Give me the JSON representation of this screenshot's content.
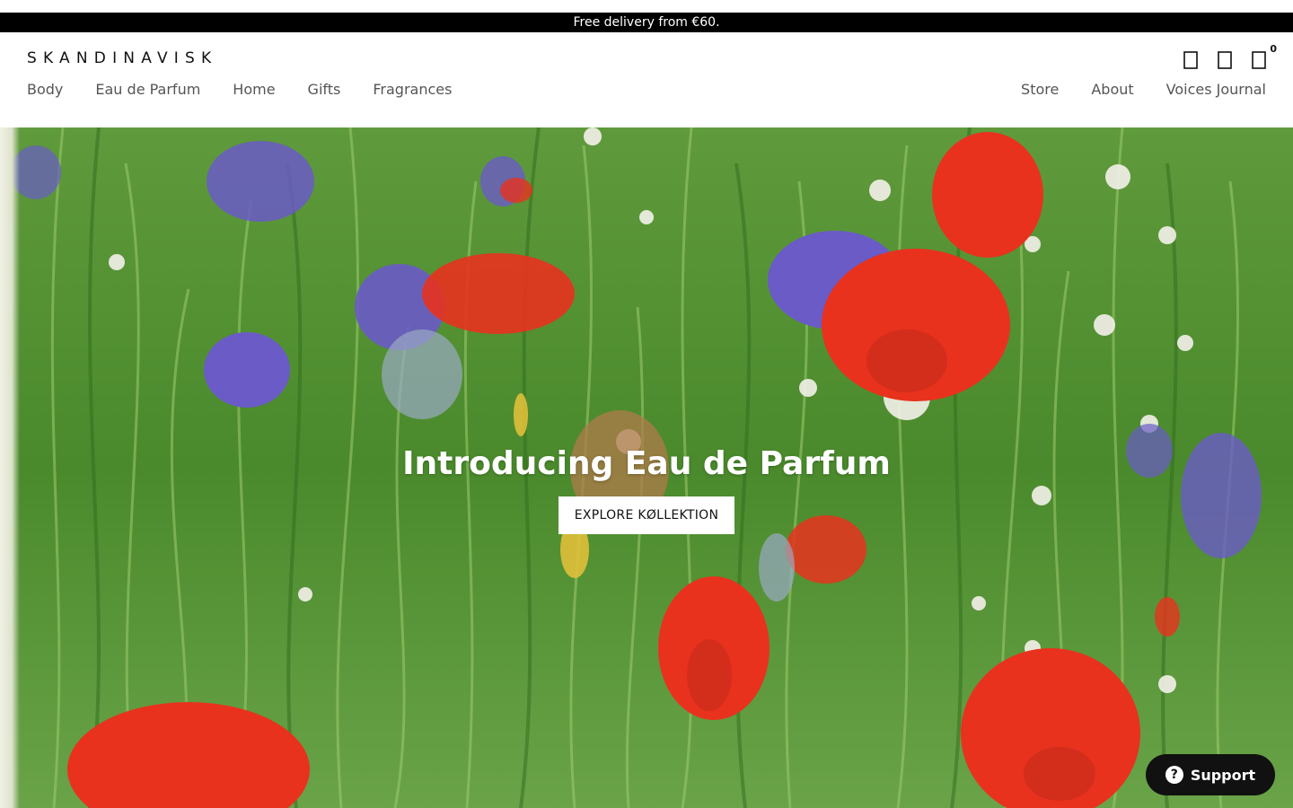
{
  "announcement": {
    "text": "Free delivery from €60."
  },
  "header": {
    "logo": "SKANDINAVISK",
    "nav_left": [
      "Body",
      "Eau de Parfum",
      "Home",
      "Gifts",
      "Fragrances"
    ],
    "nav_right": [
      "Store",
      "About",
      "Voices Journal"
    ],
    "icons": [
      "search-icon",
      "account-icon",
      "cart-icon"
    ],
    "cart_count": "0"
  },
  "hero": {
    "title": "Introducing Eau de Parfum",
    "cta": "EXPLORE KØLLEKTION"
  },
  "support": {
    "label": "Support",
    "icon": "?"
  },
  "colors": {
    "announcement_bg": "#000000",
    "accent_dark": "#111111",
    "grass": "#4f8a2f",
    "poppy": "#e8321e",
    "cornflower": "#6a5bc7"
  }
}
